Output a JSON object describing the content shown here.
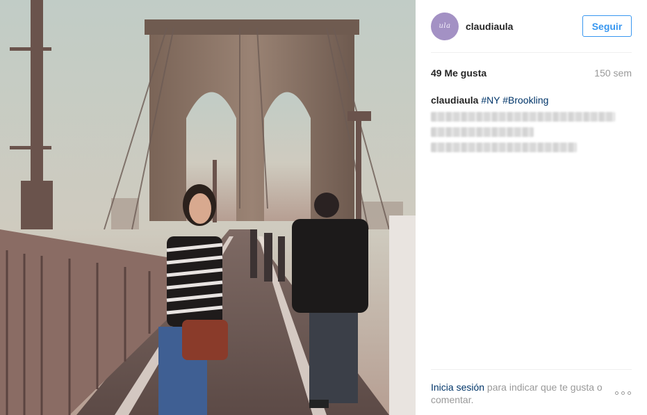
{
  "post": {
    "username": "claudiaula",
    "avatar_initials": "ula",
    "follow_label": "Seguir",
    "likes": "49 Me gusta",
    "time_ago": "150 sem",
    "caption": {
      "user": "claudiaula",
      "hashtags": [
        "#NY",
        "#Brookling"
      ]
    },
    "footer": {
      "login_link": "Inicia sesión",
      "login_rest": " para indicar que te gusta o comentar."
    }
  },
  "colors": {
    "accent": "#3897f0",
    "link": "#003569",
    "muted": "#999999",
    "avatar": "#a391c4"
  },
  "icons": {
    "more": "more-options-icon"
  }
}
